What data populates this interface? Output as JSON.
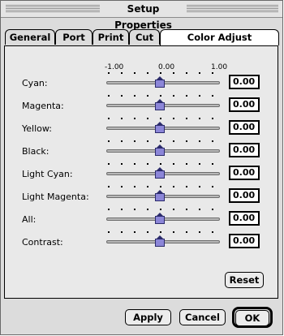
{
  "window": {
    "title": "Setup Properties"
  },
  "tabs": [
    {
      "label": "General",
      "selected": false
    },
    {
      "label": "Port",
      "selected": false
    },
    {
      "label": "Print",
      "selected": false
    },
    {
      "label": "Cut",
      "selected": false
    },
    {
      "label": "Color Adjust",
      "selected": true
    }
  ],
  "scale": {
    "min": "-1.00",
    "mid": "0.00",
    "max": "1.00"
  },
  "rows": [
    {
      "label": "Cyan:",
      "value": "0.00"
    },
    {
      "label": "Magenta:",
      "value": "0.00"
    },
    {
      "label": "Yellow:",
      "value": "0.00"
    },
    {
      "label": "Black:",
      "value": "0.00"
    },
    {
      "label": "Light Cyan:",
      "value": "0.00"
    },
    {
      "label": "Light Magenta:",
      "value": "0.00"
    },
    {
      "label": "All:",
      "value": "0.00"
    },
    {
      "label": "Contrast:",
      "value": "0.00"
    }
  ],
  "buttons": {
    "reset": "Reset",
    "apply": "Apply",
    "cancel": "Cancel",
    "ok": "OK"
  },
  "colors": {
    "thumb": "#8c86d8",
    "panel": "#e9e9e9"
  }
}
